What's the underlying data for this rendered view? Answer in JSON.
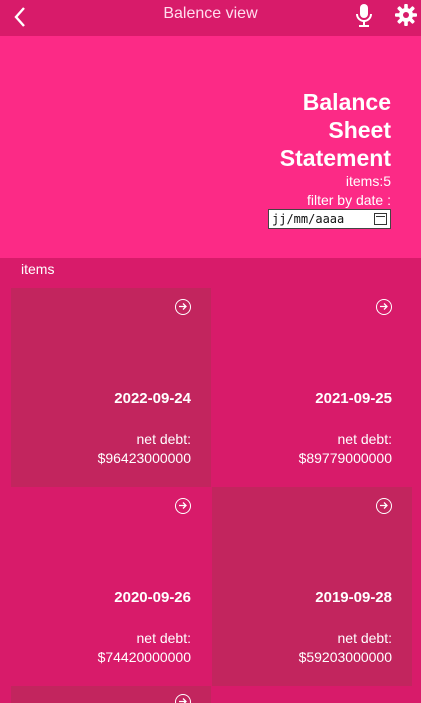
{
  "topbar": {
    "title": "Balence view"
  },
  "hero": {
    "title_lines": [
      "Balance",
      "Sheet",
      "Statement"
    ],
    "count": "items:5",
    "filter_label": "filter by date :",
    "date_placeholder": "jj/mm/aaaa"
  },
  "section": {
    "label": "items"
  },
  "cards": [
    {
      "date": "2022-09-24",
      "label": "net debt:",
      "value": "$96423000000"
    },
    {
      "date": "2021-09-25",
      "label": "net debt:",
      "value": "$89779000000"
    },
    {
      "date": "2020-09-26",
      "label": "net debt:",
      "value": "$74420000000"
    },
    {
      "date": "2019-09-28",
      "label": "net debt:",
      "value": "$59203000000"
    }
  ],
  "colors": {
    "topbar": "#d81b6a",
    "hero": "#fc2a86",
    "card_dark": "#c2255e"
  },
  "icons": {
    "back": "chevron-left-icon",
    "mic": "microphone-icon",
    "settings": "gear-icon",
    "card": "arrow-right-circle-icon"
  }
}
